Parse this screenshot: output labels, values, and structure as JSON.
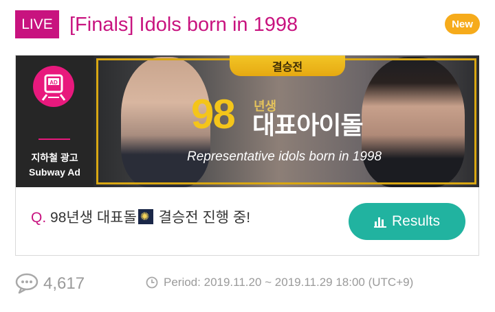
{
  "header": {
    "live_label": "LIVE",
    "title": "[Finals] Idols born in 1998",
    "new_label": "New"
  },
  "ad": {
    "icon_text": "AD",
    "label_ko": "지하철 광고",
    "label_en": "Subway Ad"
  },
  "banner": {
    "tab_label": "결승전",
    "number": "98",
    "year_suffix": "년생",
    "headline": "대표아이돌",
    "subtitle": "Representative idols born in 1998"
  },
  "question": {
    "prefix": "Q.",
    "text_before": "98년생 대표돌",
    "emoji": "fireworks",
    "text_after": "결승전 진행 중!"
  },
  "results_button": {
    "label": "Results",
    "icon": "bar-chart-icon"
  },
  "footer": {
    "comment_icon": "comment-icon",
    "count": "4,617",
    "clock_icon": "clock-icon",
    "period_label": "Period:",
    "period_value": "2019.11.20 ~ 2019.11.29 18:00 (UTC+9)"
  },
  "colors": {
    "accent_pink": "#c8137f",
    "new_badge": "#f6ab1b",
    "results_teal": "#21b3a0",
    "gold": "#f4c51a"
  }
}
